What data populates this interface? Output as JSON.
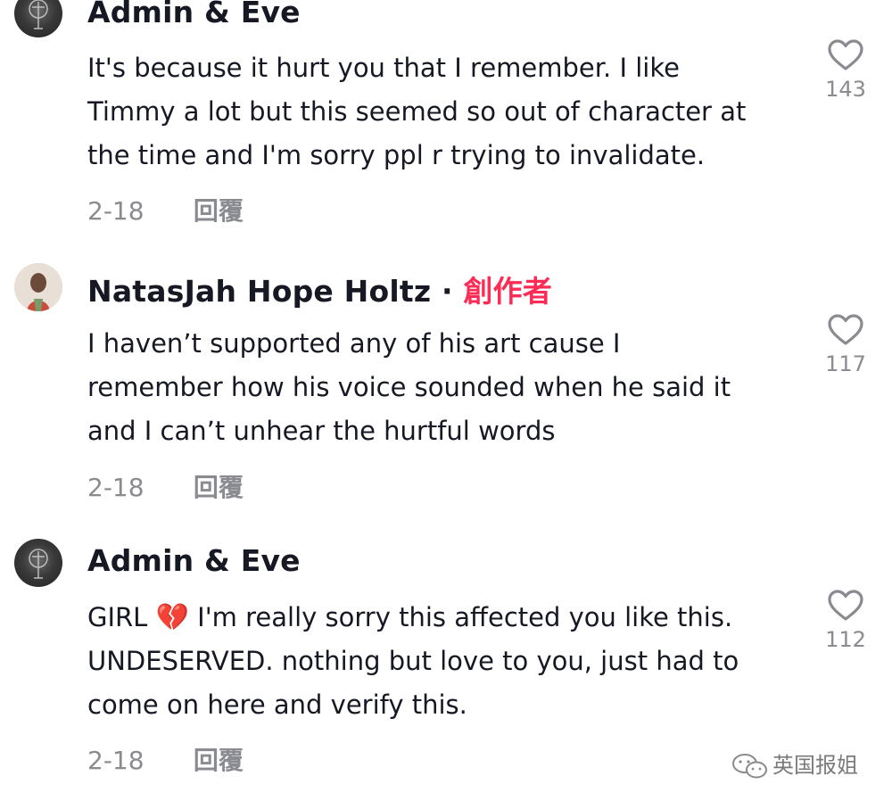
{
  "comments": [
    {
      "username": "Admin & Eve",
      "text": "It's because it hurt you that I remember. I like\nTimmy a lot but this seemed so out of character at\nthe time and I'm sorry ppl r trying to invalidate.",
      "date": "2-18",
      "reply_label": "回覆",
      "likes": "143"
    },
    {
      "username": "NatasJah Hope Holtz",
      "separator": "·",
      "creator_badge": "創作者",
      "text": "I haven’t supported any of his art cause I\nremember how his voice sounded when he said it\nand I can’t unhear the hurtful words",
      "date": "2-18",
      "reply_label": "回覆",
      "likes": "117"
    },
    {
      "username": "Admin & Eve",
      "text_prefix": "GIRL ",
      "emoji": "💔",
      "text": " I'm really sorry this affected you like this.\nUNDESERVED. nothing but love to you, just had to\ncome on here and verify this.",
      "date": "2-18",
      "reply_label": "回覆",
      "likes": "112"
    }
  ],
  "watermark": "英国报姐",
  "colors": {
    "text": "#161823",
    "muted": "#8a8b91",
    "creator": "#fe2c55"
  }
}
